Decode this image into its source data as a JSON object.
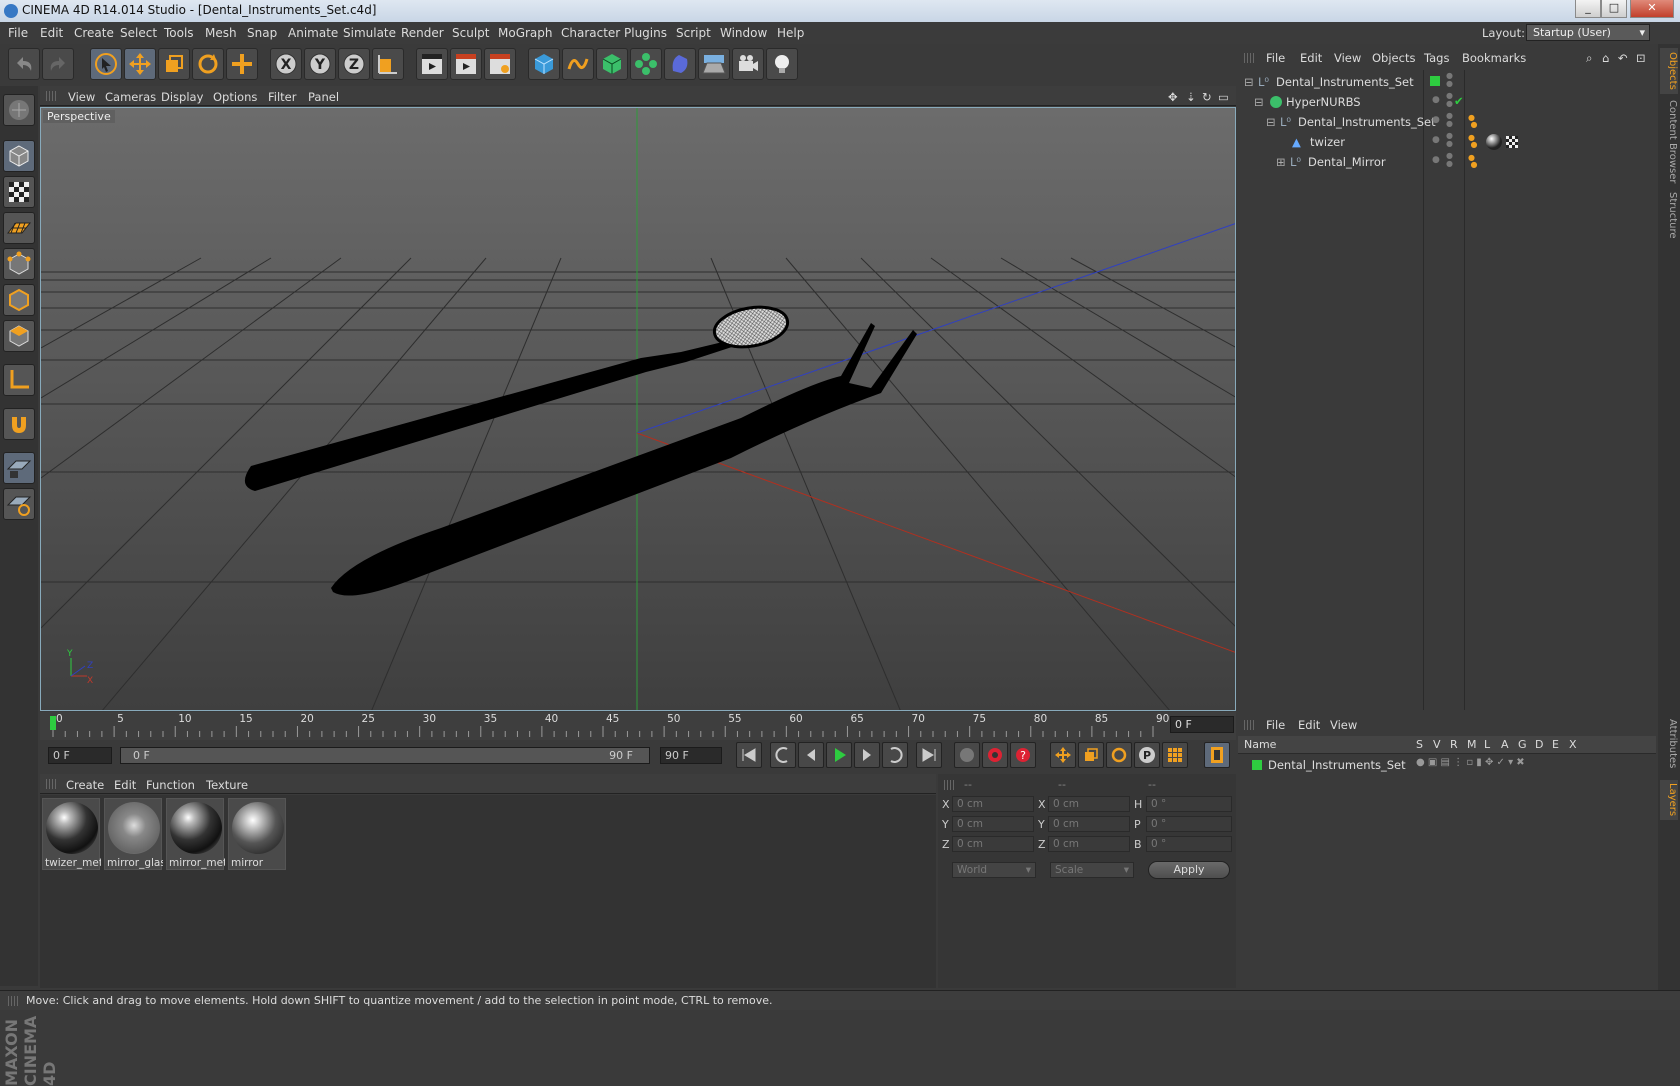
{
  "window": {
    "title": "CINEMA 4D R14.014 Studio - [Dental_Instruments_Set.c4d]",
    "controls": [
      "minimize",
      "maximize",
      "close"
    ]
  },
  "menubar": {
    "items": [
      "File",
      "Edit",
      "Create",
      "Select",
      "Tools",
      "Mesh",
      "Snap",
      "Animate",
      "Simulate",
      "Render",
      "Sculpt",
      "MoGraph",
      "Character",
      "Plugins",
      "Script",
      "Window",
      "Help"
    ],
    "layout_label": "Layout:",
    "layout_value": "Startup (User)"
  },
  "viewport": {
    "menu": [
      "View",
      "Cameras",
      "Display",
      "Options",
      "Filter",
      "Panel"
    ],
    "label": "Perspective",
    "axis": {
      "y": "Y",
      "z": "Z",
      "x": "X"
    }
  },
  "timeline": {
    "ticks": [
      "0",
      "5",
      "10",
      "15",
      "20",
      "25",
      "30",
      "35",
      "40",
      "45",
      "50",
      "55",
      "60",
      "65",
      "70",
      "75",
      "80",
      "85",
      "90"
    ],
    "current_frame": "0 F"
  },
  "transport": {
    "start": "0 F",
    "range_start": "0 F",
    "range_end": "90 F",
    "end": "90 F"
  },
  "materials": {
    "menu": [
      "Create",
      "Edit",
      "Function",
      "Texture"
    ],
    "items": [
      "twizer_met",
      "mirror_glas",
      "mirror_met",
      "mirror"
    ]
  },
  "coordinates": {
    "headers": [
      "--",
      "--",
      "--"
    ],
    "rows": [
      {
        "a": "X",
        "av": "0 cm",
        "b": "X",
        "bv": "0 cm",
        "c": "H",
        "cv": "0 °"
      },
      {
        "a": "Y",
        "av": "0 cm",
        "b": "Y",
        "bv": "0 cm",
        "c": "P",
        "cv": "0 °"
      },
      {
        "a": "Z",
        "av": "0 cm",
        "b": "Z",
        "bv": "0 cm",
        "c": "B",
        "cv": "0 °"
      }
    ],
    "world": "World",
    "scale": "Scale",
    "apply": "Apply"
  },
  "objects": {
    "menu": [
      "File",
      "Edit",
      "View",
      "Objects",
      "Tags",
      "Bookmarks"
    ],
    "tree": [
      "Dental_Instruments_Set",
      "HyperNURBS",
      "Dental_Instruments_Set",
      "twizer",
      "Dental_Mirror"
    ]
  },
  "layers": {
    "menu": [
      "File",
      "Edit",
      "View"
    ],
    "columns": [
      "Name",
      "S",
      "V",
      "R",
      "M",
      "L",
      "A",
      "G",
      "D",
      "E",
      "X"
    ],
    "rows": [
      "Dental_Instruments_Set"
    ]
  },
  "side_tabs": [
    "Objects",
    "Content Browser",
    "Structure",
    "Attributes",
    "Layers"
  ],
  "brand": "MAXON CINEMA 4D",
  "status": "Move: Click and drag to move elements. Hold down SHIFT to quantize movement / add to the selection in point mode, CTRL to remove.",
  "colors": {
    "accent": "#f0a020",
    "layer_green": "#2ecc40",
    "x_axis": "#c0392b",
    "y_axis": "#2ecc40",
    "z_axis": "#3040c0"
  }
}
